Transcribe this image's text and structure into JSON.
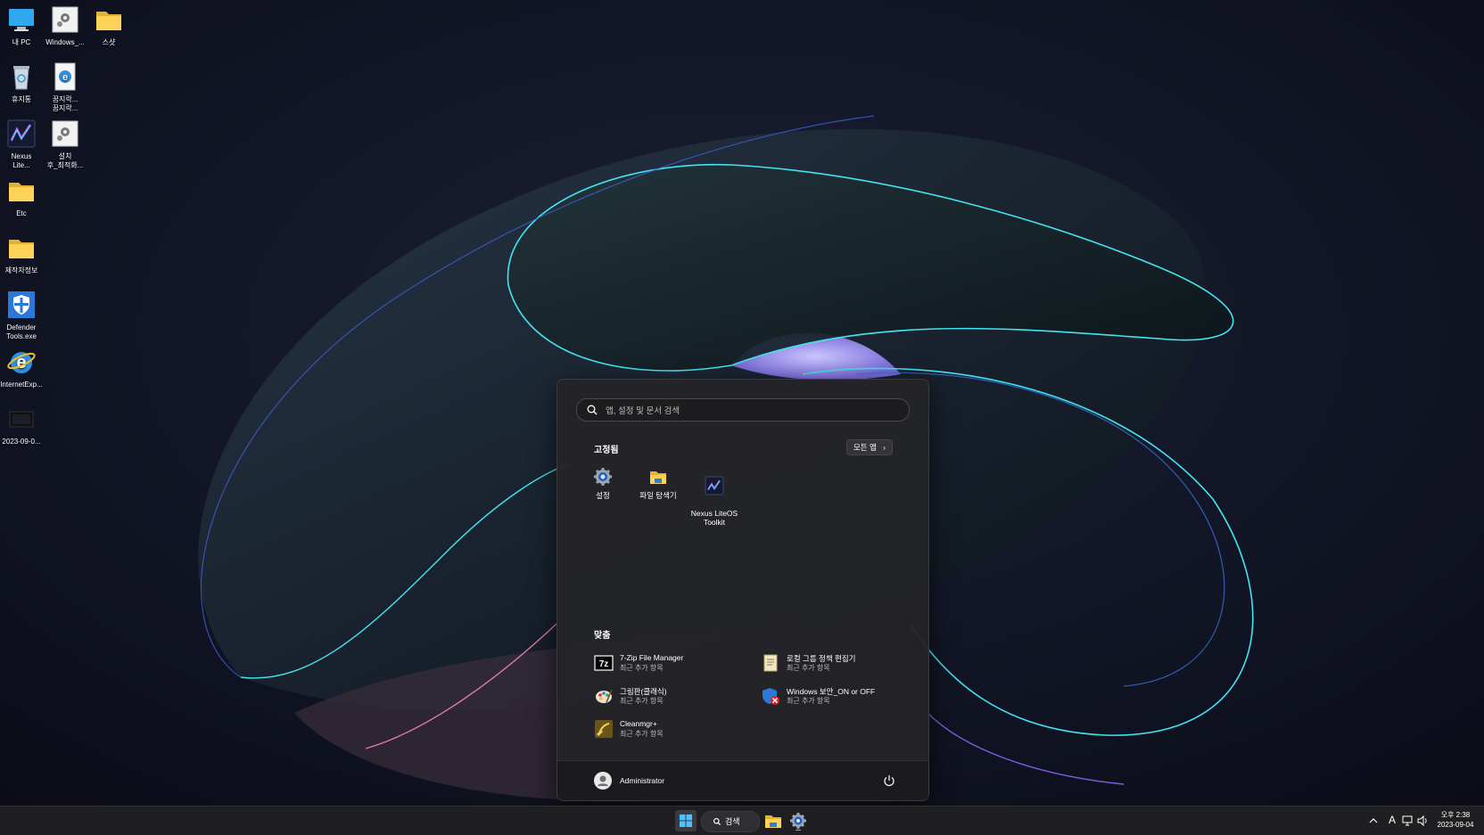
{
  "desktop": {
    "icons": [
      {
        "label": "내 PC",
        "icon": "monitor-icon"
      },
      {
        "label": "Windows_...",
        "icon": "gear-shortcut-icon"
      },
      {
        "label": "스샷",
        "icon": "folder-icon"
      },
      {
        "label": "휴지통",
        "icon": "recycle-bin-icon"
      },
      {
        "label": "꿈지락...\n꿈지락...",
        "icon": "internet-explorer-doc-icon"
      },
      {
        "label": "Nexus\nLite...",
        "icon": "nexus-lite-icon"
      },
      {
        "label": "설치\n후_최적화...",
        "icon": "gear-shortcut-icon"
      },
      {
        "label": "Etc",
        "icon": "folder-icon"
      },
      {
        "label": "제작자정보",
        "icon": "folder-icon"
      },
      {
        "label": "Defender\nTools.exe",
        "icon": "defender-shield-icon"
      },
      {
        "label": "InternetExp...",
        "icon": "internet-explorer-icon"
      },
      {
        "label": "2023-09-0...",
        "icon": "screenshot-file-icon"
      }
    ]
  },
  "start_menu": {
    "search": {
      "placeholder": "앱, 설정 및 문서 검색",
      "value": ""
    },
    "pinned_title": "고정됨",
    "all_apps_label": "모든 앱",
    "pinned_apps": [
      {
        "label": "설정",
        "icon": "settings-gear-icon"
      },
      {
        "label": "파일 탐색기",
        "icon": "file-explorer-icon"
      },
      {
        "label": "Nexus LiteOS\nToolkit",
        "icon": "nexus-lite-icon"
      }
    ],
    "recommended_title": "맞춤",
    "recommended": [
      {
        "name": "7-Zip File Manager",
        "sub": "최근 추가 항목",
        "icon": "7zip-icon"
      },
      {
        "name": "로컬 그룹 정책 편집기",
        "sub": "최근 추가 항목",
        "icon": "policy-editor-icon"
      },
      {
        "name": "그림판(클래식)",
        "sub": "최근 추가 항목",
        "icon": "paint-icon"
      },
      {
        "name": "Windows 보안_ON or OFF",
        "sub": "최근 추가 항목",
        "icon": "windows-security-icon"
      },
      {
        "name": "Cleanmgr+",
        "sub": "최근 추가 항목",
        "icon": "cleanmgr-icon"
      }
    ],
    "user_name": "Administrator"
  },
  "taskbar": {
    "search_label": "검색",
    "ime_label": "A",
    "clock_time": "오후 2:38",
    "clock_date": "2023-09-04"
  },
  "colors": {
    "accent": "#4cc2ff",
    "wallpaper_glow": "#43e3f0",
    "start_bg": "#242428"
  }
}
